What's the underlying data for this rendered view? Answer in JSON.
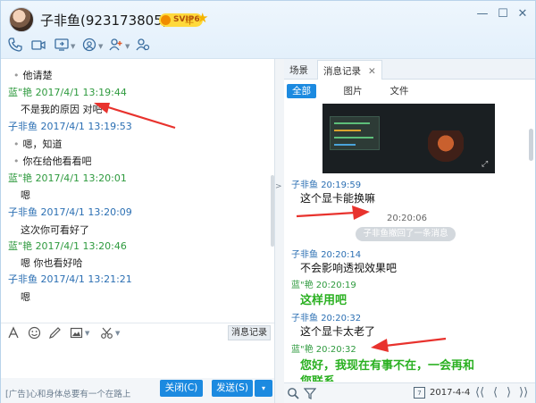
{
  "header": {
    "title": "子非鱼(923173805)",
    "svip_badge": "SVIP6",
    "year_badge": "年",
    "min_glyph": "—",
    "max_glyph": "☐",
    "close_glyph": "✕"
  },
  "toolbar_icons": [
    "phone-icon",
    "video-icon",
    "screen-share-icon",
    "add-contact-icon",
    "invite-icon",
    "group-icon"
  ],
  "left_messages": [
    {
      "kind": "text",
      "text": "他请楚",
      "bullet": true
    },
    {
      "kind": "header",
      "sender": "蓝\"艳",
      "time": "2017/4/1 13:19:44",
      "color": "green"
    },
    {
      "kind": "text",
      "text": "不是我的原因 对吧",
      "bullet": false
    },
    {
      "kind": "header",
      "sender": "子非鱼",
      "time": "2017/4/1 13:19:53",
      "color": "blue"
    },
    {
      "kind": "text",
      "text": "嗯，知道",
      "bullet": true
    },
    {
      "kind": "text",
      "text": "你在给他看看吧",
      "bullet": true
    },
    {
      "kind": "header",
      "sender": "蓝\"艳",
      "time": "2017/4/1 13:20:01",
      "color": "green"
    },
    {
      "kind": "text",
      "text": "嗯",
      "bullet": false
    },
    {
      "kind": "header",
      "sender": "子非鱼",
      "time": "2017/4/1 13:20:09",
      "color": "blue"
    },
    {
      "kind": "text",
      "text": "这次你可看好了",
      "bullet": false
    },
    {
      "kind": "header",
      "sender": "蓝\"艳",
      "time": "2017/4/1 13:20:46",
      "color": "green"
    },
    {
      "kind": "text",
      "text": "嗯 你也看好哈",
      "bullet": false
    },
    {
      "kind": "header",
      "sender": "子非鱼",
      "time": "2017/4/1 13:21:21",
      "color": "blue"
    },
    {
      "kind": "text",
      "text": "嗯",
      "bullet": false
    }
  ],
  "input_toolbar": {
    "history_label": "消息记录"
  },
  "bottom": {
    "ad_text": "[广告]心和身体总要有一个在路上",
    "close_label": "关闭(C)",
    "send_label": "发送(S)",
    "send_dropdown": "▾"
  },
  "right_panel": {
    "tabs": [
      {
        "label": "场景"
      },
      {
        "label": "消息记录",
        "close": "✕"
      }
    ],
    "filters": [
      "全部",
      "图片",
      "文件"
    ],
    "messages": [
      {
        "kind": "header",
        "sender": "子非鱼",
        "time": "20:19:59",
        "color": "blue"
      },
      {
        "kind": "text",
        "text": "这个显卡能换嘛",
        "color": "normal"
      },
      {
        "kind": "center-time",
        "text": "20:20:06"
      },
      {
        "kind": "recall",
        "text": "子非鱼撤回了一条消息"
      },
      {
        "kind": "header",
        "sender": "子非鱼",
        "time": "20:20:14",
        "color": "blue"
      },
      {
        "kind": "text",
        "text": "不会影响透视效果吧",
        "color": "normal"
      },
      {
        "kind": "header",
        "sender": "蓝\"艳",
        "time": "20:20:19",
        "color": "green"
      },
      {
        "kind": "text",
        "text": "这样用吧",
        "color": "green"
      },
      {
        "kind": "header",
        "sender": "子非鱼",
        "time": "20:20:32",
        "color": "blue"
      },
      {
        "kind": "text",
        "text": "这个显卡太老了",
        "color": "normal"
      },
      {
        "kind": "header",
        "sender": "蓝\"艳",
        "time": "20:20:32",
        "color": "green"
      },
      {
        "kind": "text",
        "text": "您好，我现在有事不在，一会再和",
        "color": "green"
      },
      {
        "kind": "text",
        "text": "您联系",
        "color": "green"
      }
    ],
    "date": "2017-4-4",
    "calendar_glyph": "7",
    "nav": [
      "⟨⟨",
      "⟨",
      "⟩",
      "⟩⟩"
    ]
  },
  "colors": {
    "accent": "#1c8ae0",
    "sender_green": "#2e9a3e",
    "sender_blue": "#2b6fb3",
    "auto_reply_green": "#29b020",
    "annotation_red": "#e8322d"
  }
}
